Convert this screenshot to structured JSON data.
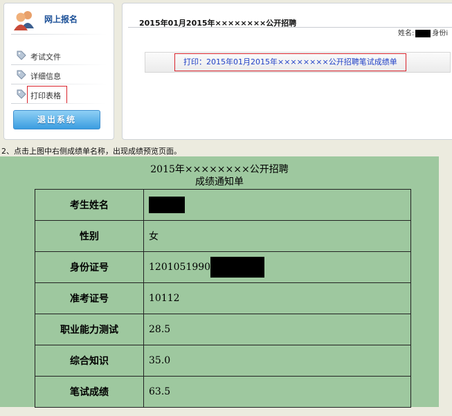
{
  "portal": {
    "sidebar": {
      "title": "网上报名",
      "items": [
        {
          "label": "考试文件"
        },
        {
          "label": "详细信息"
        },
        {
          "label": "打印表格"
        }
      ],
      "logout_label": "退出系统"
    },
    "main": {
      "title": "2015年01月2015年××××××××公开招聘",
      "name_label": "姓名:",
      "id_label": "身份i",
      "print_link": "打印：2015年01月2015年××××××××公开招聘笔试成绩单"
    }
  },
  "caption": "2、点击上图中右侧成绩单名称，出现成绩预览页面。",
  "score_sheet": {
    "title_line1": "2015年××××××××公开招聘",
    "title_line2": "成绩通知单",
    "rows": [
      {
        "label": "考生姓名",
        "value": ""
      },
      {
        "label": "性别",
        "value": "女"
      },
      {
        "label": "身份证号",
        "value": "1201051990"
      },
      {
        "label": "准考证号",
        "value": "10112"
      },
      {
        "label": "职业能力测试",
        "value": "28.5"
      },
      {
        "label": "综合知识",
        "value": "35.0"
      },
      {
        "label": "笔试成绩",
        "value": "63.5"
      }
    ]
  },
  "colors": {
    "sheet_bg": "#9ec89f",
    "link": "#1f3fc6",
    "highlight_border": "#d9232b",
    "title_blue": "#1a4f97"
  }
}
